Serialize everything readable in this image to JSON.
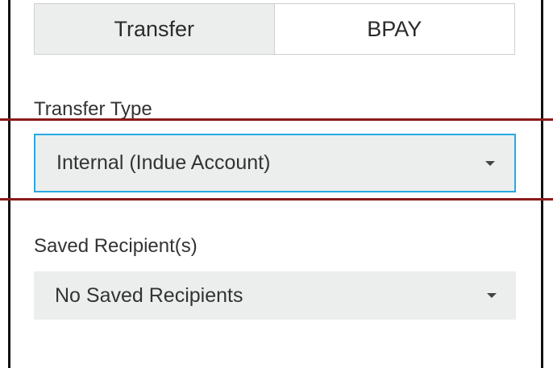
{
  "tabs": [
    {
      "label": "Transfer",
      "active": true
    },
    {
      "label": "BPAY",
      "active": false
    }
  ],
  "transfer_type": {
    "label": "Transfer Type",
    "value": "Internal (Indue Account)",
    "focus_color": "#27a9e1"
  },
  "saved_recipients": {
    "label": "Saved Recipient(s)",
    "value": "No Saved Recipients"
  },
  "icons": {
    "dropdown": "chevron-down-icon"
  },
  "colors": {
    "annotation_line": "#8b1a1a",
    "field_background": "#eceeee",
    "active_tab_background": "#eceeee"
  }
}
